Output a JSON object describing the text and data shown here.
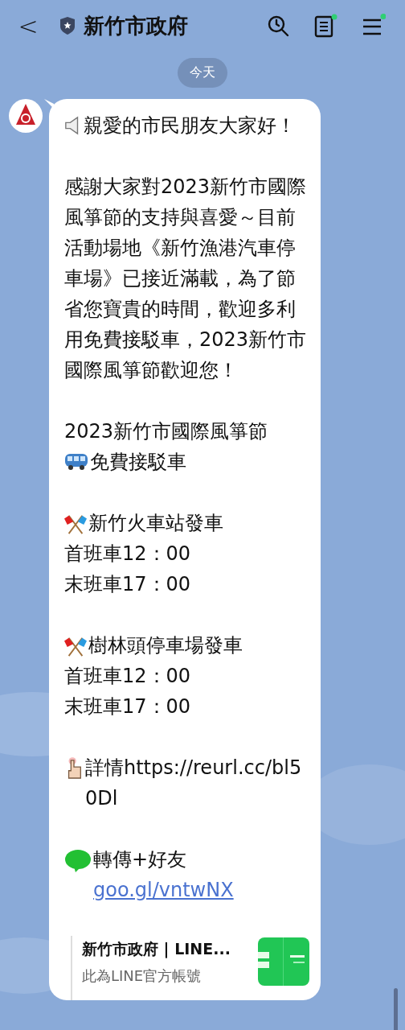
{
  "header": {
    "back": "<",
    "title": "新竹市政府",
    "verified": true,
    "notes_badge": true,
    "menu_badge": true
  },
  "date_chip": "今天",
  "message": {
    "blocks": [
      {
        "lines": [
          {
            "kind": "speaker",
            "text": "親愛的市民朋友大家好！"
          }
        ]
      },
      {
        "lines": [
          {
            "text": "感謝大家對2023新竹市國際風箏節的支持與喜愛～目前活動場地《新竹漁港汽車停車場》已接近滿載，為了節省您寶貴的時間，歡迎多利用免費接駁車，2023新竹市國際風箏節歡迎您！"
          }
        ]
      },
      {
        "lines": [
          {
            "text": "2023新竹市國際風箏節"
          },
          {
            "kind": "bus",
            "text": "免費接駁車"
          }
        ]
      },
      {
        "lines": [
          {
            "kind": "flags",
            "text": "新竹火車站發車"
          },
          {
            "text": "首班車12：00"
          },
          {
            "text": "末班車17：00"
          }
        ]
      },
      {
        "lines": [
          {
            "kind": "flags",
            "text": "樹林頭停車場發車"
          },
          {
            "text": "首班車12：00"
          },
          {
            "text": "末班車17：00"
          }
        ]
      },
      {
        "lines": [
          {
            "kind": "pointer",
            "text": "詳情https://reurl.cc/bl50Dl"
          }
        ]
      },
      {
        "lines": [
          {
            "kind": "line",
            "text": "轉傳+好友 ",
            "link": "goo.gl/vntwNX"
          }
        ]
      }
    ],
    "preview": {
      "title": "新竹市政府 | LINE...",
      "description": "此為LINE官方帳號"
    }
  }
}
